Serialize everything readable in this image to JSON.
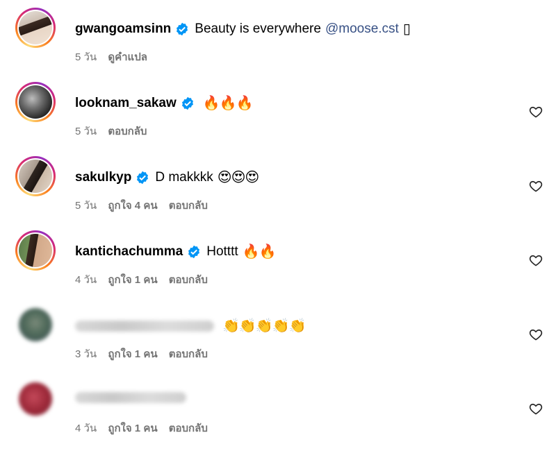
{
  "comments": [
    {
      "username": "gwangoamsinn",
      "verified": true,
      "text": "Beauty is everywhere",
      "mention": "@moose.cst",
      "emoji": "▯",
      "time": "5 วัน",
      "likes": "",
      "action": "ดูคำแปล",
      "has_heart": false,
      "avatar_icon": "profile-photo"
    },
    {
      "username": "looknam_sakaw",
      "verified": true,
      "text": "",
      "mention": "",
      "emoji": "🔥🔥🔥",
      "time": "5 วัน",
      "likes": "",
      "action": "ตอบกลับ",
      "has_heart": true,
      "avatar_icon": "profile-photo"
    },
    {
      "username": "sakulkyp",
      "verified": true,
      "text": "D makkkk",
      "mention": "",
      "emoji": "😍😍😍",
      "time": "5 วัน",
      "likes": "ถูกใจ 4 คน",
      "action": "ตอบกลับ",
      "has_heart": true,
      "avatar_icon": "profile-photo"
    },
    {
      "username": "kantichachumma",
      "verified": true,
      "text": "Hotttt",
      "mention": "",
      "emoji": "🔥🔥",
      "time": "4 วัน",
      "likes": "ถูกใจ 1 คน",
      "action": "ตอบกลับ",
      "has_heart": true,
      "avatar_icon": "profile-photo"
    },
    {
      "username": "",
      "verified": false,
      "text": "",
      "mention": "",
      "emoji": "👏👏👏👏👏",
      "time": "3 วัน",
      "likes": "ถูกใจ 1 คน",
      "action": "ตอบกลับ",
      "has_heart": true,
      "avatar_icon": "blurred-profile-photo"
    },
    {
      "username": "",
      "verified": false,
      "text": "",
      "mention": "",
      "emoji": "",
      "time": "4 วัน",
      "likes": "ถูกใจ 1 คน",
      "action": "ตอบกลับ",
      "has_heart": true,
      "avatar_icon": "blurred-profile-photo"
    }
  ],
  "colors": {
    "verified": "#0095f6",
    "mention": "#385185",
    "meta_text": "#737373"
  },
  "icons": {
    "verified": "verified-badge-icon",
    "like": "heart-icon"
  }
}
